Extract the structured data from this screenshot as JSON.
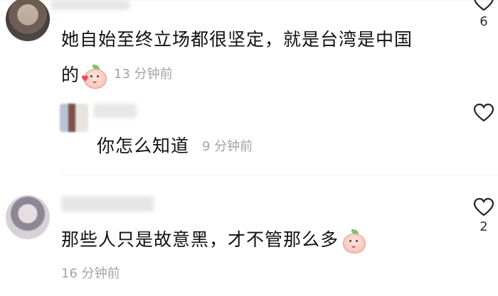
{
  "comments": [
    {
      "text_line1": "她自始至终立场都很坚定，就是台湾是中国",
      "text_line2": "的",
      "time": "13 分钟前",
      "likes": "6"
    },
    {
      "text": "你怎么知道",
      "time": "9 分钟前"
    },
    {
      "text": "那些人只是故意黑，才不管那么多",
      "time": "16 分钟前",
      "likes": "2"
    }
  ],
  "icons": {
    "like": "heart-outline-icon",
    "emoji": "peach-emoji-icon"
  }
}
